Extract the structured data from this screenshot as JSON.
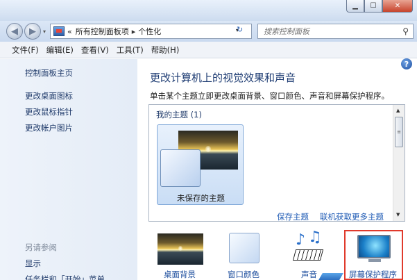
{
  "window": {
    "min_glyph": "▁",
    "max_glyph": "☐",
    "close_glyph": "✕"
  },
  "address_bar": {
    "chevron": "«",
    "crumb_1": "所有控制面板项",
    "separator": "▸",
    "crumb_2": "个性化",
    "dropdown_glyph": "▾",
    "refresh_glyph": "↻"
  },
  "search": {
    "placeholder": "搜索控制面板",
    "icon_glyph": "⚲"
  },
  "menu": [
    "文件(F)",
    "编辑(E)",
    "查看(V)",
    "工具(T)",
    "帮助(H)"
  ],
  "sidebar": {
    "items": [
      "控制面板主页",
      "更改桌面图标",
      "更改鼠标指针",
      "更改帐户图片"
    ],
    "see_also_header": "另请参阅",
    "see_also": [
      "显示",
      "任务栏和「开始」菜单"
    ]
  },
  "main": {
    "heading": "更改计算机上的视觉效果和声音",
    "subtext": "单击某个主题立即更改桌面背景、窗口颜色、声音和屏幕保护程序。",
    "my_themes_header": "我的主题 (1)",
    "unsaved_theme_label": "未保存的主题",
    "save_theme_link": "保存主题",
    "get_more_link": "联机获取更多主题",
    "help_glyph": "?"
  },
  "bottom": {
    "desktop_background": "桌面背景",
    "window_color": "窗口颜色",
    "sound": "声音",
    "screen_saver": "屏幕保护程序"
  },
  "colors": {
    "accent_link": "#1f5bb5",
    "heading": "#1e3c73",
    "highlight_border": "#e03a2c"
  }
}
